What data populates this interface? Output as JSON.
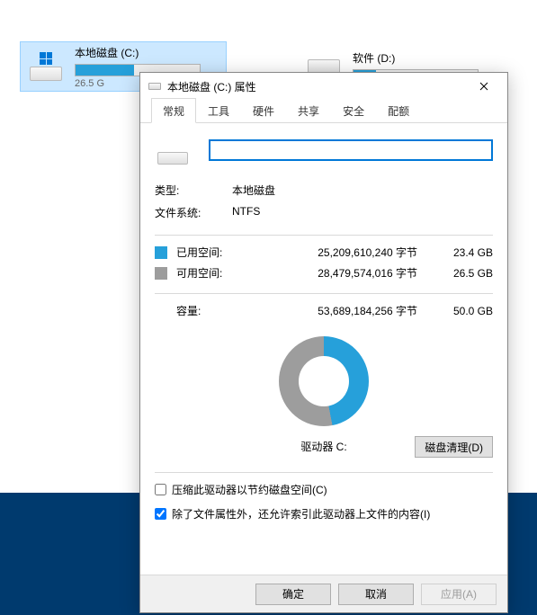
{
  "explorer": {
    "drives": [
      {
        "name": "本地磁盘 (C:)",
        "free": "26.5 G",
        "fill_pct": 47,
        "selected": true
      },
      {
        "name": "软件 (D:)",
        "free": "",
        "fill_pct": 18,
        "selected": false
      }
    ]
  },
  "dialog": {
    "title": "本地磁盘 (C:) 属性",
    "tabs": [
      "常规",
      "工具",
      "硬件",
      "共享",
      "安全",
      "配额"
    ],
    "active_tab": 0,
    "label_value": "",
    "type_label": "类型:",
    "type_value": "本地磁盘",
    "fs_label": "文件系统:",
    "fs_value": "NTFS",
    "used_label": "已用空间:",
    "used_bytes": "25,209,610,240 字节",
    "used_hr": "23.4 GB",
    "free_label": "可用空间:",
    "free_bytes": "28,479,574,016 字节",
    "free_hr": "26.5 GB",
    "cap_label": "容量:",
    "cap_bytes": "53,689,184,256 字节",
    "cap_hr": "50.0 GB",
    "pie_label": "驱动器 C:",
    "cleanup_btn": "磁盘清理(D)",
    "compress_label": "压缩此驱动器以节约磁盘空间(C)",
    "index_label": "除了文件属性外，还允许索引此驱动器上文件的内容(I)",
    "compress_checked": false,
    "index_checked": true,
    "ok": "确定",
    "cancel": "取消",
    "apply": "应用(A)"
  },
  "chart_data": {
    "type": "pie",
    "title": "驱动器 C:",
    "series": [
      {
        "name": "已用空间",
        "value": 25209610240,
        "human": "23.4 GB",
        "color": "#26a0da"
      },
      {
        "name": "可用空间",
        "value": 28479574016,
        "human": "26.5 GB",
        "color": "#9d9d9d"
      }
    ],
    "total": {
      "name": "容量",
      "value": 53689184256,
      "human": "50.0 GB"
    }
  }
}
